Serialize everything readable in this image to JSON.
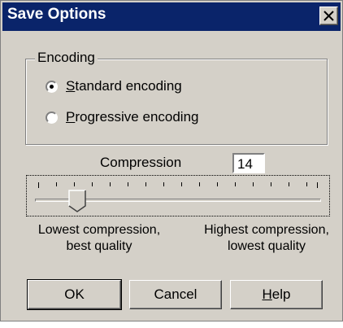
{
  "window": {
    "title": "Save Options",
    "close_label": "Close"
  },
  "encoding": {
    "group_label": "Encoding",
    "options": [
      {
        "label": "Standard encoding",
        "mnemonic": "S",
        "rest": "tandard encoding",
        "selected": true
      },
      {
        "label": "Progressive encoding",
        "mnemonic": "P",
        "rest": "rogressive encoding",
        "selected": false
      }
    ]
  },
  "compression": {
    "label": "Compression",
    "value": "14",
    "slider_value": 14,
    "slider_min": 0,
    "slider_max": 100,
    "low_caption_line1": "Lowest compression,",
    "low_caption_line2": "best quality",
    "high_caption_line1": "Highest compression,",
    "high_caption_line2": "lowest quality"
  },
  "buttons": {
    "ok": "OK",
    "cancel": "Cancel",
    "help_mnemonic": "H",
    "help_rest": "elp"
  },
  "colors": {
    "titlebar": "#0a246a",
    "face": "#d4d0c8"
  }
}
